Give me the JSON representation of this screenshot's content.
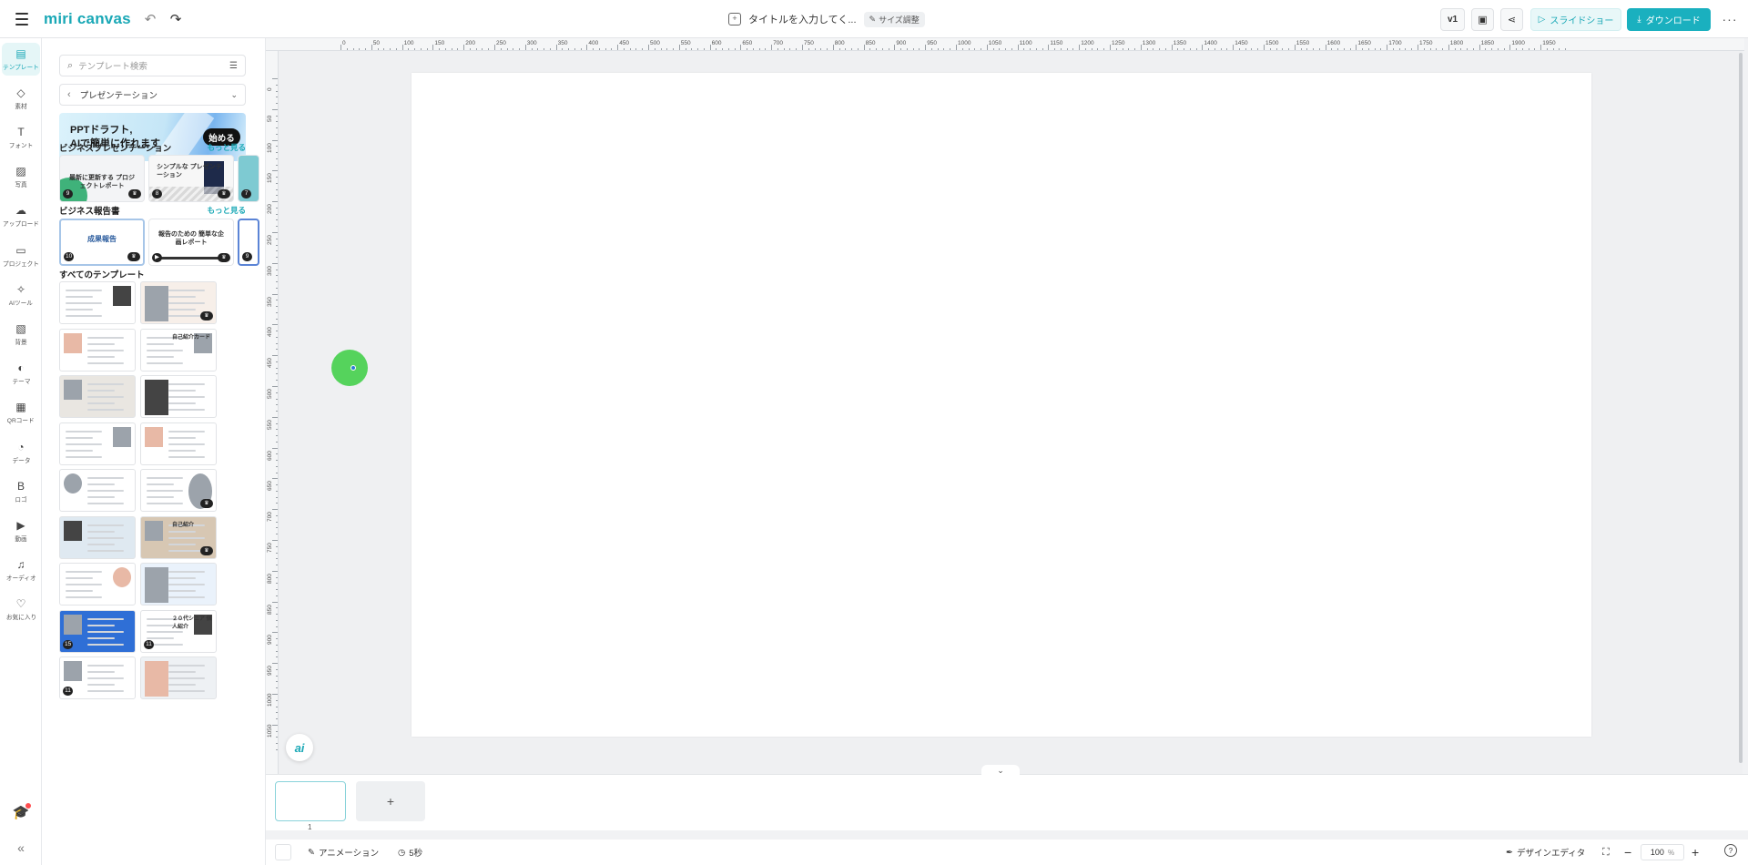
{
  "app": {
    "logo": "miri canvas",
    "doc_title": "タイトルを入力してく...",
    "size_adjust": "サイズ調整",
    "version": "v1",
    "slideshow": "スライドショー",
    "download": "ダウンロード",
    "more": "···"
  },
  "rail": [
    {
      "label": "テンプレート",
      "icon": "layout-icon",
      "glyph": "▤"
    },
    {
      "label": "素材",
      "icon": "shapes-icon",
      "glyph": "◇"
    },
    {
      "label": "フォント",
      "icon": "text-icon",
      "glyph": "T"
    },
    {
      "label": "写真",
      "icon": "image-icon",
      "glyph": "▨"
    },
    {
      "label": "アップロード",
      "icon": "upload-icon",
      "glyph": "☁"
    },
    {
      "label": "プロジェクト",
      "icon": "folder-icon",
      "glyph": "▭"
    },
    {
      "label": "AIツール",
      "icon": "sparkle-icon",
      "glyph": "✧"
    },
    {
      "label": "背景",
      "icon": "pattern-icon",
      "glyph": "▧"
    },
    {
      "label": "テーマ",
      "icon": "palette-icon",
      "glyph": "◐"
    },
    {
      "label": "QRコード",
      "icon": "qr-icon",
      "glyph": "▦"
    },
    {
      "label": "データ",
      "icon": "chart-icon",
      "glyph": "◔"
    },
    {
      "label": "ロゴ",
      "icon": "logo-b-icon",
      "glyph": "B"
    },
    {
      "label": "動画",
      "icon": "play-icon",
      "glyph": "▶"
    },
    {
      "label": "オーディオ",
      "icon": "music-icon",
      "glyph": "♫"
    },
    {
      "label": "お気に入り",
      "icon": "heart-icon",
      "glyph": "♡"
    }
  ],
  "panel": {
    "search_placeholder": "テンプレート検索",
    "category": "プレゼンテーション",
    "banner_line1": "PPTドラフト,",
    "banner_line2": "AIで簡単に作れます",
    "banner_button": "始める",
    "sections": [
      {
        "title": "ビジネスプレゼンテーション",
        "more": "もっと見る"
      },
      {
        "title": "ビジネス報告書",
        "more": "もっと見る"
      },
      {
        "title": "すべてのテンプレート",
        "more": ""
      }
    ],
    "biz_pres": [
      {
        "badge": "9",
        "caption": "最新に更新する プロジェクトレポート"
      },
      {
        "badge": "8",
        "caption": "シンプルな プレゼンテーション"
      },
      {
        "badge": "7",
        "caption": ""
      }
    ],
    "biz_report": [
      {
        "badge": "10",
        "caption": "成果報告"
      },
      {
        "badge": "▶",
        "caption": "報告のための 簡単な企画レポート"
      },
      {
        "badge": "9",
        "caption": ""
      }
    ],
    "all_badges": [
      "15",
      "11",
      "11"
    ],
    "all_captions": [
      "自己紹介カード",
      "自己紹介",
      "２０代シニア 個人紹介"
    ]
  },
  "ruler": {
    "h": [
      "0",
      "50",
      "100",
      "150",
      "200",
      "250",
      "300",
      "350",
      "400",
      "450",
      "500",
      "550",
      "600",
      "650",
      "700",
      "750",
      "800",
      "850",
      "900",
      "950",
      "1000",
      "1050",
      "1100",
      "1150",
      "1200",
      "1250",
      "1300",
      "1350",
      "1400",
      "1450",
      "1500",
      "1550",
      "1600",
      "1650",
      "1700",
      "1750",
      "1800",
      "1850",
      "1900",
      "1950"
    ],
    "v": [
      "0",
      "50",
      "100",
      "150",
      "200",
      "250",
      "300",
      "350",
      "400",
      "450",
      "500",
      "550",
      "600",
      "650",
      "700",
      "750",
      "800",
      "850",
      "900",
      "950",
      "1000",
      "1050"
    ]
  },
  "canvas": {
    "ai_fab": "ai"
  },
  "pages": {
    "thumb_number": "1",
    "add": "+"
  },
  "status": {
    "animation": "アニメーション",
    "duration": "5秒",
    "design_editor": "デザインエディタ",
    "zoom": "100",
    "zoom_unit": "%",
    "help": "?"
  }
}
